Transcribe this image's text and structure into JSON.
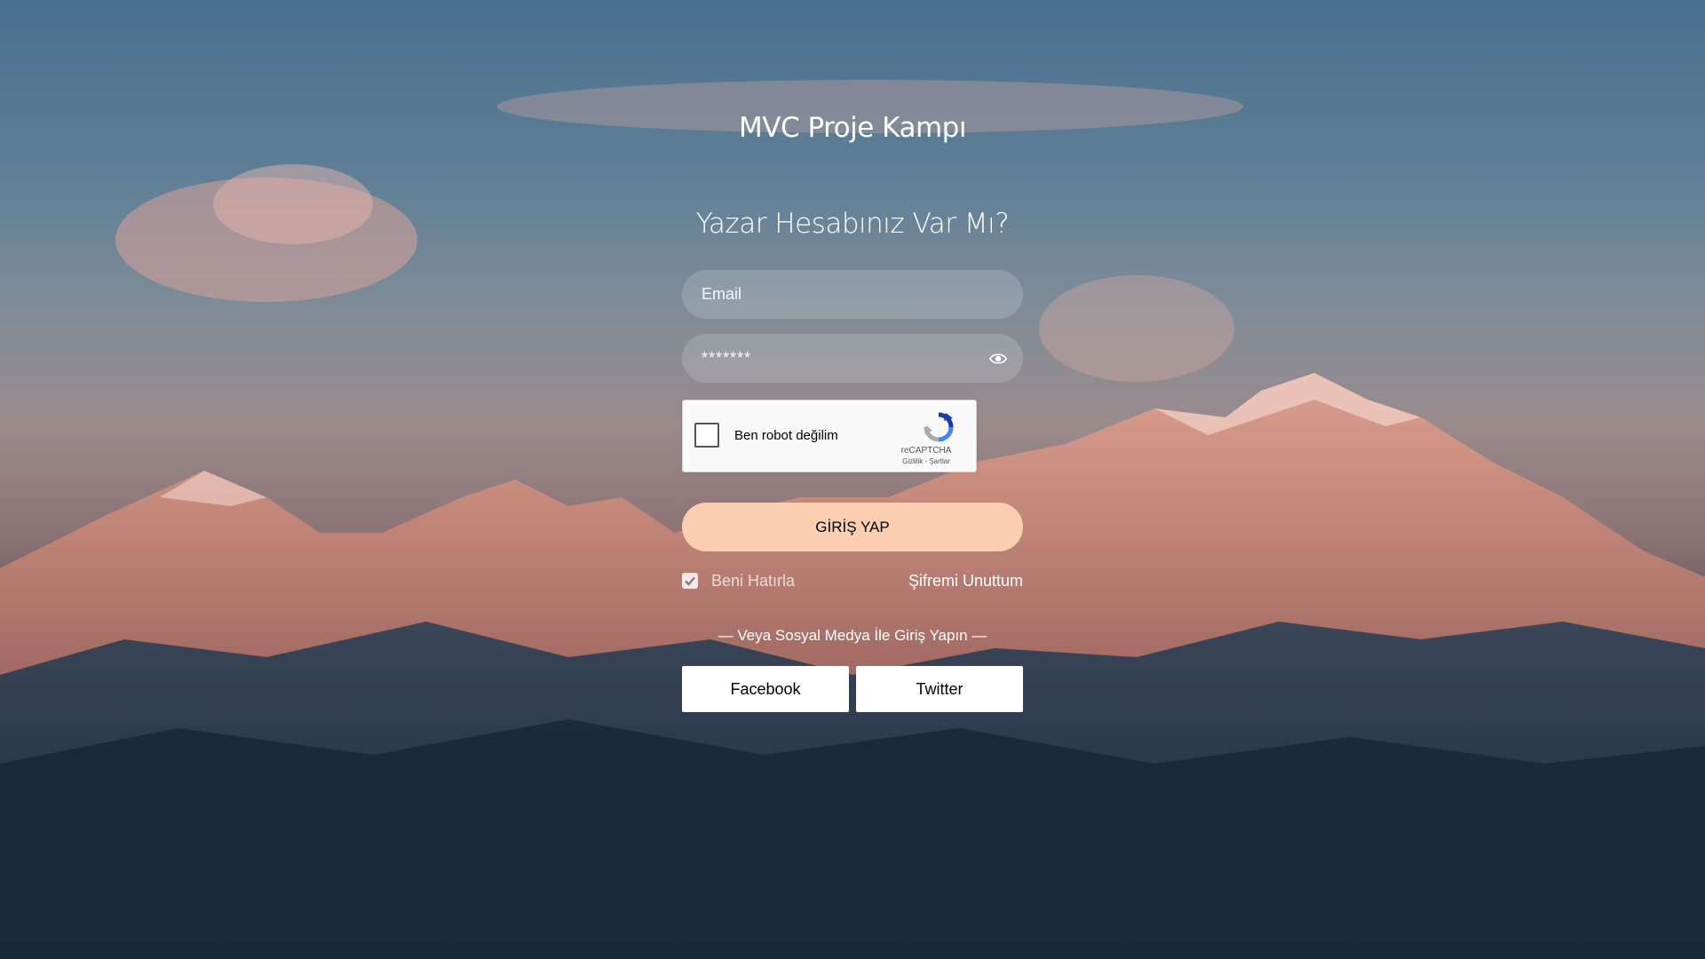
{
  "brand": {
    "title": "MVC Proje Kampı"
  },
  "login": {
    "heading": "Yazar Hesabınız Var Mı?",
    "email_placeholder": "Email",
    "password_value": "*******",
    "submit_label": "GİRİŞ YAP",
    "remember_label": "Beni Hatırla",
    "remember_checked": true,
    "forgot_label": "Şifremi Unuttum"
  },
  "captcha": {
    "label": "Ben robot değilim",
    "brand": "reCAPTCHA",
    "links": "Gizlilik - Şartlar"
  },
  "social": {
    "divider": "— Veya Sosyal Medya İle Giriş Yapın —",
    "facebook_label": "Facebook",
    "twitter_label": "Twitter"
  },
  "colors": {
    "submit_bg": "#fbceb1",
    "sky_top": "#4a7090",
    "mountain_glow": "#d88a75"
  },
  "icons": {
    "password_toggle": "eye-icon",
    "captcha_logo": "recaptcha-icon",
    "remember_check": "check-icon"
  }
}
